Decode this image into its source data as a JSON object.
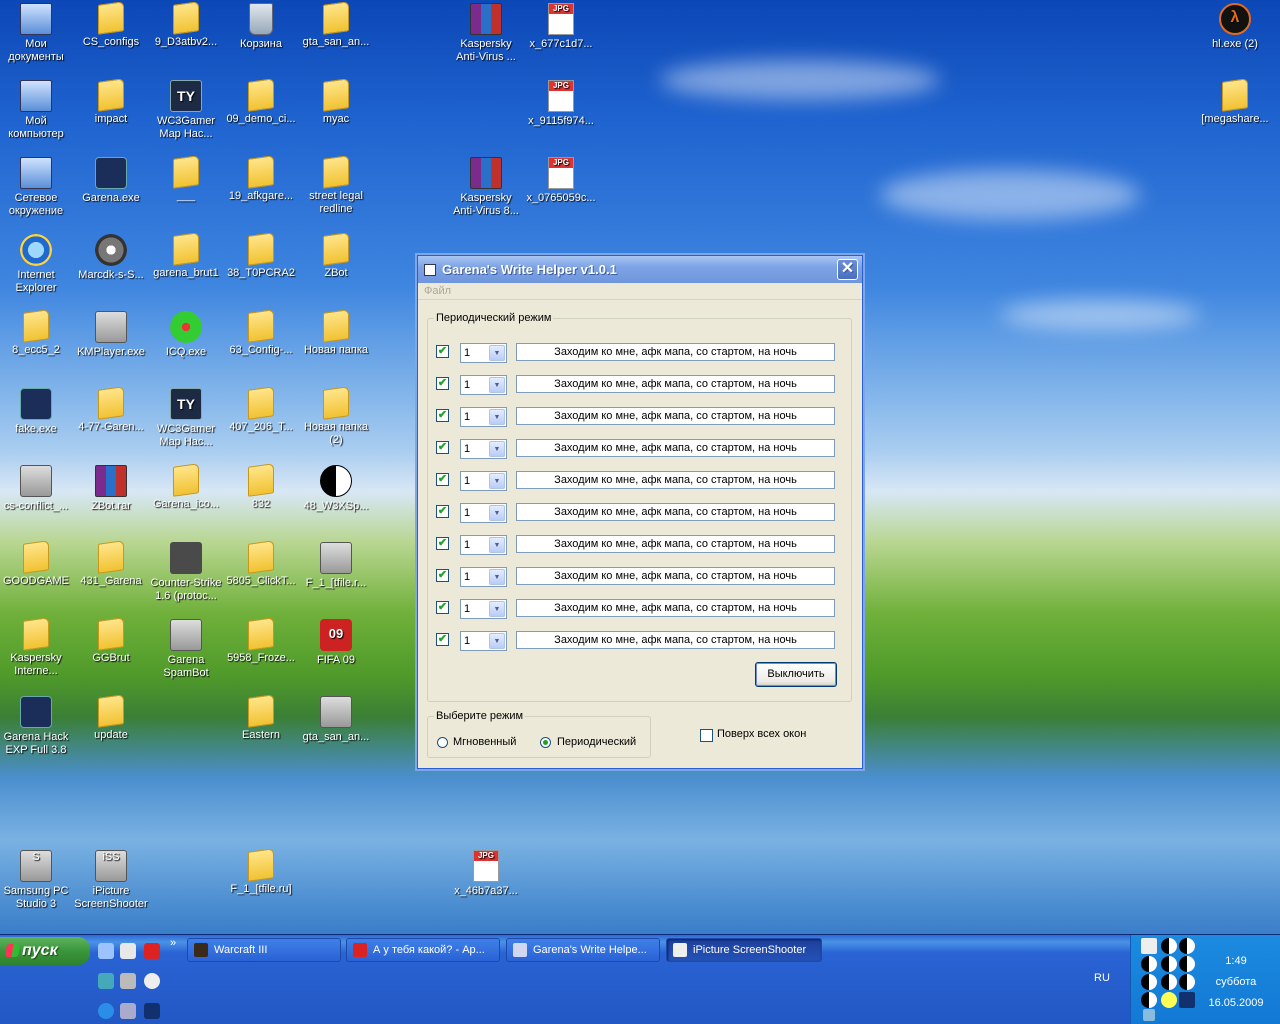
{
  "desktop": {
    "icons": [
      {
        "label": "Мои\nдокументы",
        "icon": "my-documents-icon",
        "type": "comp",
        "glyph": ""
      },
      {
        "label": "CS_configs",
        "icon": "folder-icon",
        "type": "folder",
        "glyph": ""
      },
      {
        "label": "9_D3atbv2...",
        "icon": "folder-icon",
        "type": "folder",
        "glyph": ""
      },
      {
        "label": "Корзина",
        "icon": "recycle-bin-icon",
        "type": "bin",
        "glyph": ""
      },
      {
        "label": "gta_san_an...",
        "icon": "folder-icon",
        "type": "folder",
        "glyph": ""
      },
      {
        "label": "Kaspersky\nAnti-Virus ...",
        "icon": "winrar-archive-icon",
        "type": "rar",
        "glyph": ""
      },
      {
        "label": "x_677c1d7...",
        "icon": "jpg-file-icon",
        "type": "jpg",
        "glyph": "JPG"
      },
      {
        "label": "hl.exe (2)",
        "icon": "half-life-icon",
        "type": "hl",
        "glyph": "λ"
      },
      {
        "label": "Мой\nкомпьютер",
        "icon": "my-computer-icon",
        "type": "comp",
        "glyph": ""
      },
      {
        "label": "impact",
        "icon": "folder-icon",
        "type": "folder",
        "glyph": ""
      },
      {
        "label": "WC3Gamer\nMap Hac...",
        "icon": "wc3gamer-icon",
        "type": "exe",
        "glyph": "TY"
      },
      {
        "label": "09_demo_ci...",
        "icon": "folder-icon",
        "type": "folder",
        "glyph": ""
      },
      {
        "label": "myac",
        "icon": "folder-icon",
        "type": "folder",
        "glyph": ""
      },
      {
        "label": "x_9115f974...",
        "icon": "jpg-file-icon",
        "type": "jpg",
        "glyph": "JPG"
      },
      {
        "label": "[megashare...",
        "icon": "folder-icon",
        "type": "folder",
        "glyph": ""
      },
      {
        "label": "Сетевое\nокружение",
        "icon": "network-icon",
        "type": "comp",
        "glyph": ""
      },
      {
        "label": "Garena.exe",
        "icon": "garena-icon",
        "type": "garena",
        "glyph": ""
      },
      {
        "label": "___",
        "icon": "folder-icon",
        "type": "folder",
        "glyph": ""
      },
      {
        "label": "19_afkgare...",
        "icon": "folder-icon",
        "type": "folder",
        "glyph": ""
      },
      {
        "label": "street legal\nredline",
        "icon": "folder-icon",
        "type": "folder",
        "glyph": ""
      },
      {
        "label": "Kaspersky\nAnti-Virus 8...",
        "icon": "winrar-archive-icon",
        "type": "rar",
        "glyph": ""
      },
      {
        "label": "x_0765059c...",
        "icon": "jpg-file-icon",
        "type": "jpg",
        "glyph": "JPG"
      },
      {
        "label": "Internet\nExplorer",
        "icon": "internet-explorer-icon",
        "type": "ie",
        "glyph": ""
      },
      {
        "label": "Marcdk-s-S...",
        "icon": "gear-icon",
        "type": "gear",
        "glyph": ""
      },
      {
        "label": "garena_brut1",
        "icon": "folder-icon",
        "type": "folder",
        "glyph": ""
      },
      {
        "label": "38_T0PCRA2",
        "icon": "folder-icon",
        "type": "folder",
        "glyph": ""
      },
      {
        "label": "ZBot",
        "icon": "folder-icon",
        "type": "folder",
        "glyph": ""
      },
      {
        "label": "8_ecc5_2",
        "icon": "folder-icon",
        "type": "folder",
        "glyph": ""
      },
      {
        "label": "KMPlayer.exe",
        "icon": "kmplayer-icon",
        "type": "misc",
        "glyph": ""
      },
      {
        "label": "ICQ.exe",
        "icon": "icq-flower-icon",
        "type": "flower",
        "glyph": ""
      },
      {
        "label": "63_Config-...",
        "icon": "folder-icon",
        "type": "folder",
        "glyph": ""
      },
      {
        "label": "Новая папка",
        "icon": "folder-icon",
        "type": "folder",
        "glyph": ""
      },
      {
        "label": "fake.exe",
        "icon": "garena-eye-icon",
        "type": "garena",
        "glyph": ""
      },
      {
        "label": "4-77-Garen...",
        "icon": "folder-icon",
        "type": "folder",
        "glyph": ""
      },
      {
        "label": "WC3Gamer\nMap Hac...",
        "icon": "wc3gamer-icon",
        "type": "exe",
        "glyph": "TY"
      },
      {
        "label": "407_206_T...",
        "icon": "folder-icon",
        "type": "folder",
        "glyph": ""
      },
      {
        "label": "Новая папка\n(2)",
        "icon": "folder-icon",
        "type": "folder",
        "glyph": ""
      },
      {
        "label": "cs-conflict_...",
        "icon": "cs-conflict-icon",
        "type": "misc",
        "glyph": ""
      },
      {
        "label": "ZBot.rar",
        "icon": "winrar-archive-icon",
        "type": "rar",
        "glyph": ""
      },
      {
        "label": "Garena_ico...",
        "icon": "folder-icon",
        "type": "folder",
        "glyph": ""
      },
      {
        "label": "832",
        "icon": "folder-icon",
        "type": "folder",
        "glyph": ""
      },
      {
        "label": "48_W3XSp...",
        "icon": "yin-yang-icon",
        "type": "yin",
        "glyph": ""
      },
      {
        "label": "GOODGAME",
        "icon": "folder-icon",
        "type": "folder",
        "glyph": ""
      },
      {
        "label": "431_Garena",
        "icon": "folder-icon",
        "type": "folder",
        "glyph": ""
      },
      {
        "label": "Counter-Strike\n1.6 (protoc...",
        "icon": "counter-strike-icon",
        "type": "cs",
        "glyph": ""
      },
      {
        "label": "5805_ClickT...",
        "icon": "folder-icon",
        "type": "folder",
        "glyph": ""
      },
      {
        "label": "F_1_[tfile.r...",
        "icon": "torrent-file-icon",
        "type": "misc",
        "glyph": ""
      },
      {
        "label": "Kaspersky\nInterne...",
        "icon": "folder-icon",
        "type": "folder",
        "glyph": ""
      },
      {
        "label": "GGBrut",
        "icon": "folder-icon",
        "type": "folder",
        "glyph": ""
      },
      {
        "label": "Garena\nSpamBot",
        "icon": "garena-spambot-icon",
        "type": "misc",
        "glyph": ""
      },
      {
        "label": "5958_Froze...",
        "icon": "folder-icon",
        "type": "folder",
        "glyph": ""
      },
      {
        "label": "FIFA 09",
        "icon": "fifa-icon",
        "type": "red",
        "glyph": "09"
      },
      {
        "label": "Garena Hack\nEXP Full 3.8",
        "icon": "garena-hack-icon",
        "type": "garena",
        "glyph": ""
      },
      {
        "label": "update",
        "icon": "folder-icon",
        "type": "folder",
        "glyph": ""
      },
      {
        "label": "Eastern",
        "icon": "folder-icon",
        "type": "folder",
        "glyph": ""
      },
      {
        "label": "gta_san_an...",
        "icon": "torrent-file-icon",
        "type": "misc",
        "glyph": ""
      },
      {
        "label": "Samsung PC\nStudio 3",
        "icon": "samsung-pc-studio-icon",
        "type": "misc",
        "glyph": "S"
      },
      {
        "label": "iPicture\nScreenShooter",
        "icon": "ipicture-icon",
        "type": "misc",
        "glyph": "iSS"
      },
      {
        "label": "F_1_[tfile.ru]",
        "icon": "folder-icon",
        "type": "folder",
        "glyph": ""
      },
      {
        "label": "x_46b7a37...",
        "icon": "jpg-file-icon",
        "type": "jpg",
        "glyph": "JPG"
      }
    ]
  },
  "window": {
    "title": "Garena's Write Helper v1.0.1",
    "menu": {
      "file": "Файл"
    },
    "periodic_group": {
      "legend": "Периодический режим",
      "rows": [
        {
          "checked": true,
          "interval": "1",
          "message": "Заходим ко мне, афк мапа, со стартом, на ночь"
        },
        {
          "checked": true,
          "interval": "1",
          "message": "Заходим ко мне, афк мапа, со стартом, на ночь"
        },
        {
          "checked": true,
          "interval": "1",
          "message": "Заходим ко мне, афк мапа, со стартом, на ночь"
        },
        {
          "checked": true,
          "interval": "1",
          "message": "Заходим ко мне, афк мапа, со стартом, на ночь"
        },
        {
          "checked": true,
          "interval": "1",
          "message": "Заходим ко мне, афк мапа, со стартом, на ночь"
        },
        {
          "checked": true,
          "interval": "1",
          "message": "Заходим ко мне, афк мапа, со стартом, на ночь"
        },
        {
          "checked": true,
          "interval": "1",
          "message": "Заходим ко мне, афк мапа, со стартом, на ночь"
        },
        {
          "checked": true,
          "interval": "1",
          "message": "Заходим ко мне, афк мапа, со стартом, на ночь"
        },
        {
          "checked": true,
          "interval": "1",
          "message": "Заходим ко мне, афк мапа, со стартом, на ночь"
        },
        {
          "checked": true,
          "interval": "1",
          "message": "Заходим ко мне, афк мапа, со стартом, на ночь"
        }
      ],
      "off_button": "Выключить"
    },
    "mode_group": {
      "legend": "Выберите режим",
      "instant": "Мгновенный",
      "periodic": "Периодический",
      "selected": "periodic"
    },
    "always_on_top": {
      "label": "Поверх всех окон",
      "checked": false
    }
  },
  "taskbar": {
    "start_label": "пуск",
    "tasks": [
      {
        "label": "Warcraft III",
        "icon": "warcraft-icon",
        "active": false
      },
      {
        "label": "А у тебя какой? - Ар...",
        "icon": "opera-icon",
        "active": false
      },
      {
        "label": "Garena's Write Helpe...",
        "icon": "window-icon",
        "active": false
      },
      {
        "label": "iPicture ScreenShooter",
        "icon": "ipicture-icon",
        "active": true
      }
    ],
    "language": "RU",
    "clock": {
      "time": "1:49",
      "day": "суббота",
      "date": "16.05.2009"
    }
  }
}
